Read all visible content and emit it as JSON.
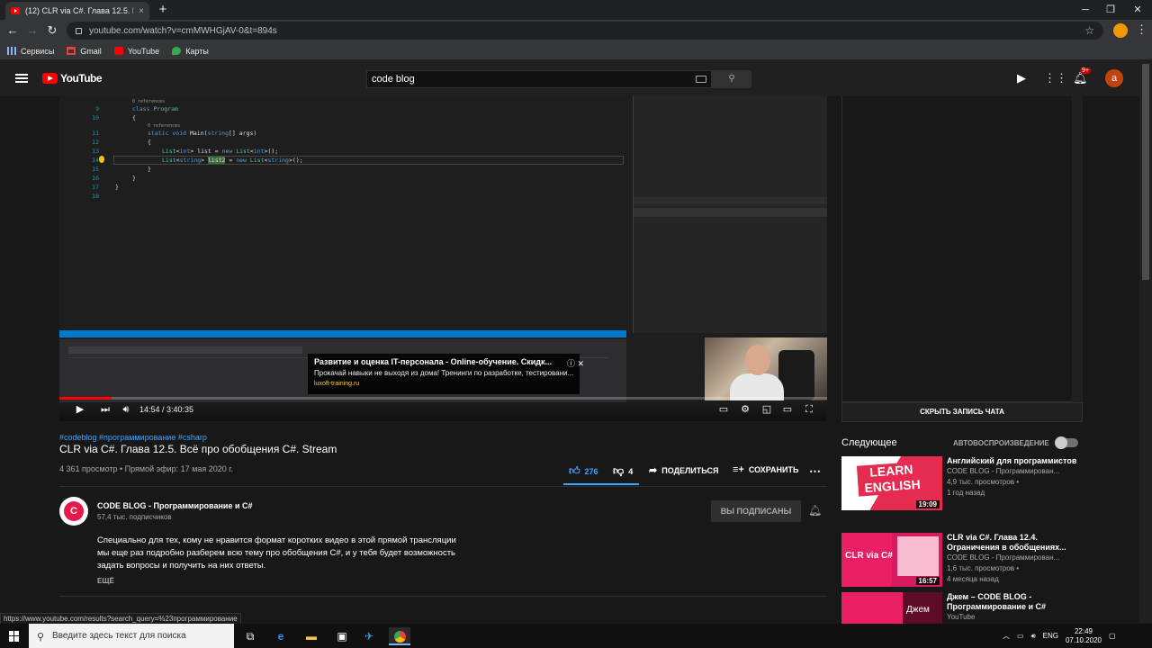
{
  "browser": {
    "tab_title": "(12) CLR via C#. Глава 12.5. Всё п",
    "tab_close": "×",
    "new_tab": "+",
    "url": "youtube.com/watch?v=cmMWHGjAV-0&t=894s",
    "bookmarks": [
      {
        "label": "Сервисы",
        "icon": "apps-icon",
        "color": "#8ab4f8"
      },
      {
        "label": "Gmail",
        "icon": "gmail-icon",
        "color": "#ea4335"
      },
      {
        "label": "YouTube",
        "icon": "youtube-icon",
        "color": "#ff0000"
      },
      {
        "label": "Карты",
        "icon": "maps-icon",
        "color": "#34a853"
      }
    ],
    "status_url": "https://www.youtube.com/results?search_query=%23программирование"
  },
  "youtube": {
    "logo_text": "YouTube",
    "search_value": "code blog",
    "notifications_badge": "9+",
    "user_initial": "a"
  },
  "code": {
    "line_numbers": [
      "9",
      "10",
      "11",
      "12",
      "13",
      "14",
      "15",
      "16",
      "17",
      "18"
    ],
    "refs_label": "0 references"
  },
  "player": {
    "time": "14:54 / 3:40:35",
    "progress_fraction": 0.0676,
    "ad": {
      "title": "Развитие и оценка IT-персонала - Online-обучение. Скидк...",
      "text": "Прокачай навыки не выходя из дома! Тренинги по разработке, тестировани...",
      "url": "luxoft-training.ru"
    }
  },
  "chat": {
    "hide_label": "СКРЫТЬ ЗАПИСЬ ЧАТА"
  },
  "video": {
    "tags": "#codeblog #программирование #csharp",
    "title": "CLR via C#. Глава 12.5. Всё про обобщения C#. Stream",
    "views": "4 361 просмотр • Прямой эфир: 17 мая 2020 г.",
    "likes": "276",
    "dislikes": "4",
    "share_label": "ПОДЕЛИТЬСЯ",
    "save_label": "СОХРАНИТЬ",
    "like_fraction": 0.986
  },
  "channel": {
    "name": "CODE BLOG - Программирование и C#",
    "subs": "57,4 тыс. подписчиков",
    "subscribed_label": "ВЫ ПОДПИСАНЫ",
    "avatar_letter": "C",
    "description": "Специально для тех, кому не нравится формат коротких видео в этой прямой трансляции мы еще раз подробно разберем всю тему про обобщения C#, и у тебя будет возможность задать вопросы и получить на них ответы.",
    "more_label": "ЕЩЁ"
  },
  "sidebar": {
    "next_label": "Следующее",
    "autoplay_label": "АВТОВОСПРОИЗВЕДЕНИЕ",
    "autoplay_on": false,
    "videos": [
      {
        "title": "Английский для программистов",
        "channel": "CODE BLOG - Программирован...",
        "views": "4,9 тыс. просмотров •",
        "age": "1 год назад",
        "duration": "19:09",
        "thumb_text": "LEARN ENGLISH"
      },
      {
        "title": "CLR via C#. Глава 12.4. Ограничения в обобщениях...",
        "channel": "CODE BLOG - Программирован...",
        "views": "1,6 тыс. просмотров •",
        "age": "4 месяца назад",
        "duration": "16:57",
        "thumb_text": "CLR via C#"
      },
      {
        "title": "Джем – CODE BLOG - Программирование и C#",
        "channel": "YouTube",
        "views": "",
        "age": "",
        "duration": "",
        "thumb_text": "Джем"
      }
    ]
  },
  "taskbar": {
    "search_placeholder": "Введите здесь текст для поиска",
    "lang": "ENG",
    "time": "22:49",
    "date": "07.10.2020"
  }
}
